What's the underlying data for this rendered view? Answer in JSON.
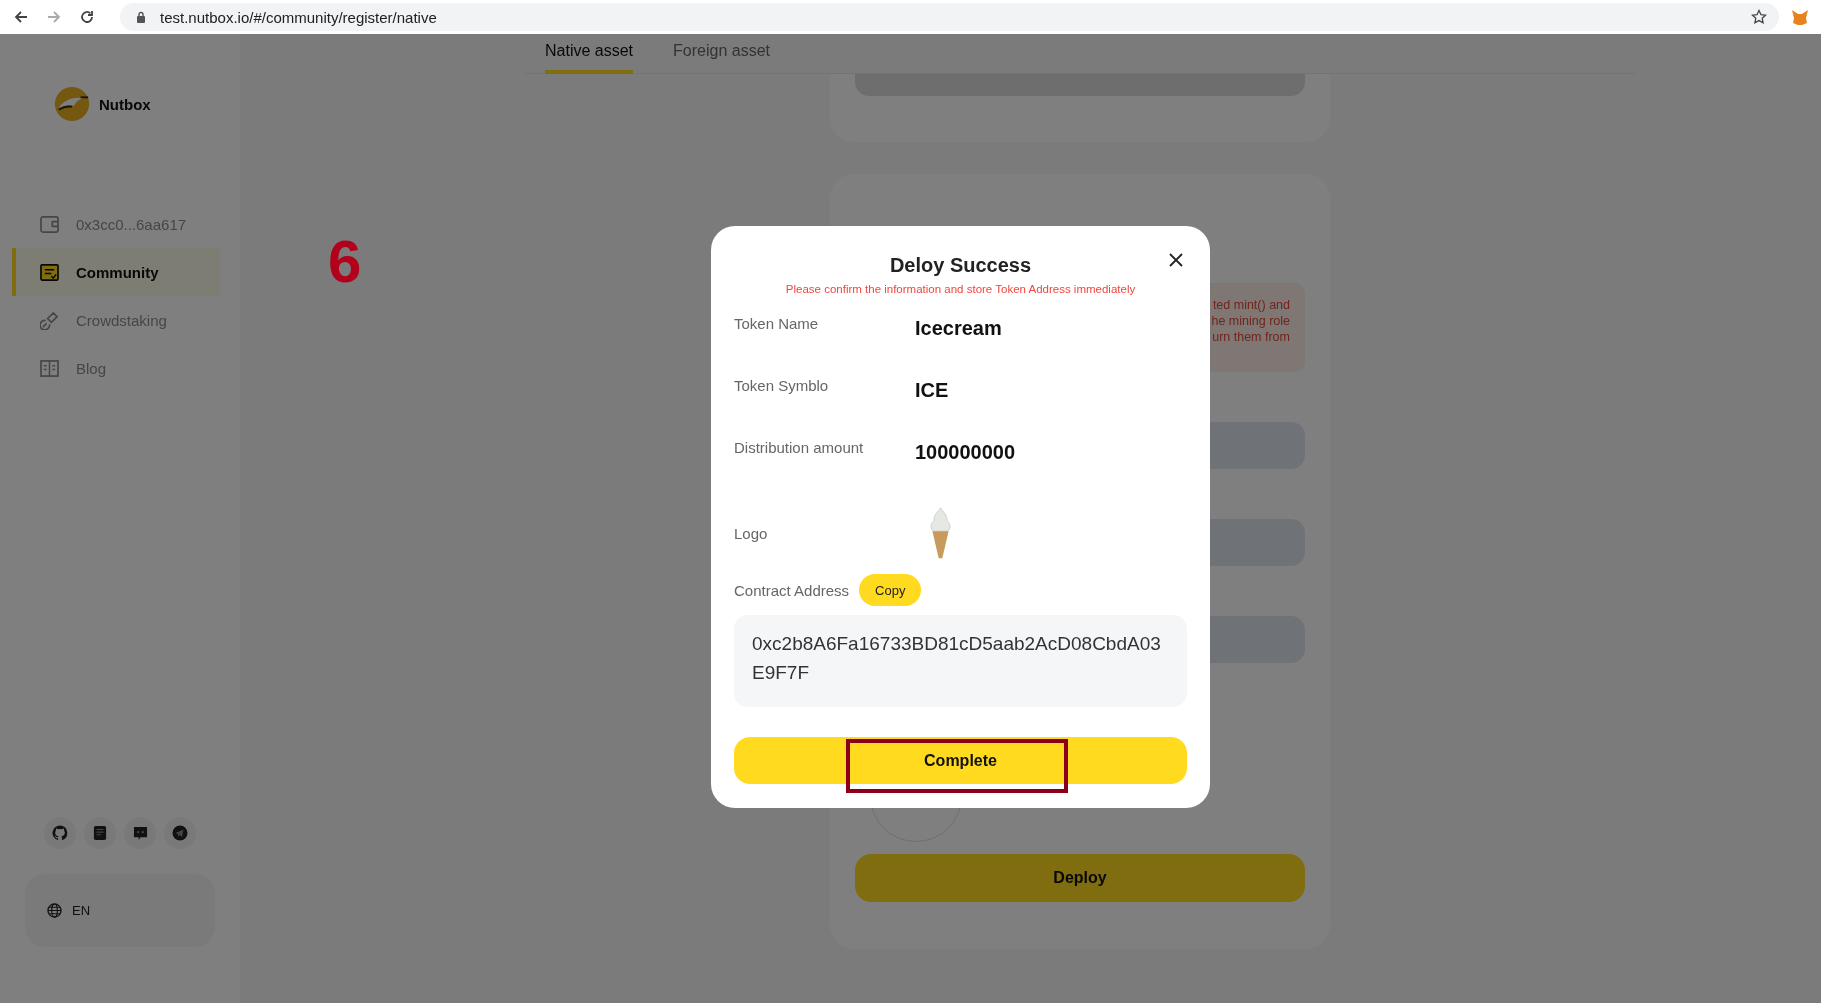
{
  "browser": {
    "url": "test.nutbox.io/#/community/register/native"
  },
  "sidebar": {
    "brand": "Nutbox",
    "nav": [
      {
        "label": "0x3cc0...6aa617",
        "selected": false
      },
      {
        "label": "Community",
        "selected": true
      },
      {
        "label": "Crowdstaking",
        "selected": false
      },
      {
        "label": "Blog",
        "selected": false
      }
    ],
    "language": "EN"
  },
  "tabs": [
    {
      "label": "Native asset",
      "selected": true
    },
    {
      "label": "Foreign asset",
      "selected": false
    }
  ],
  "form": {
    "warning_lines": [
      "ted mint() and",
      "he mining role",
      "urn them from"
    ],
    "deploy_button": "Deploy"
  },
  "annotation": {
    "step": "6"
  },
  "modal": {
    "title": "Deloy Success",
    "notice": "Please confirm the information and store Token Address immediately",
    "fields": [
      {
        "label": "Token Name",
        "value": "Icecream"
      },
      {
        "label": "Token Symblo",
        "value": "ICE"
      },
      {
        "label": "Distribution amount",
        "value": "100000000"
      }
    ],
    "logo_label": "Logo",
    "address_label": "Contract Address",
    "copy_button": "Copy",
    "address": "0xc2b8A6Fa16733BD81cD5aab2AcD08CbdA03E9F7F",
    "complete_button": "Complete"
  }
}
